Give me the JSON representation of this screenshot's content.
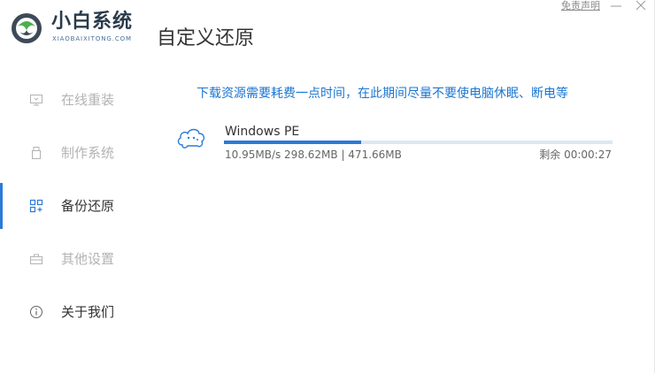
{
  "header": {
    "brand_name": "小白系统",
    "brand_subtitle": "XIAOBAIXITONG.COM",
    "page_title": "自定义还原",
    "disclaimer_label": "免责声明"
  },
  "sidebar": {
    "items": [
      {
        "label": "在线重装",
        "icon": "monitor-icon",
        "active": false
      },
      {
        "label": "制作系统",
        "icon": "usb-drive-icon",
        "active": false
      },
      {
        "label": "备份还原",
        "icon": "grid-icon",
        "active": true
      },
      {
        "label": "其他设置",
        "icon": "toolbox-icon",
        "active": false
      },
      {
        "label": "关于我们",
        "icon": "info-icon",
        "active": false
      }
    ]
  },
  "main": {
    "notice": "下载资源需要耗费一点时间，在此期间尽量不要使电脑休眠、断电等",
    "download": {
      "name": "Windows PE",
      "stats": "10.95MB/s 298.62MB | 471.66MB",
      "remaining": "剩余 00:00:27",
      "progress": 0.3533
    }
  },
  "colors": {
    "accent": "#2b7ad8",
    "notice_text": "#1b76d1",
    "inactive_nav": "#b3b3b3"
  }
}
